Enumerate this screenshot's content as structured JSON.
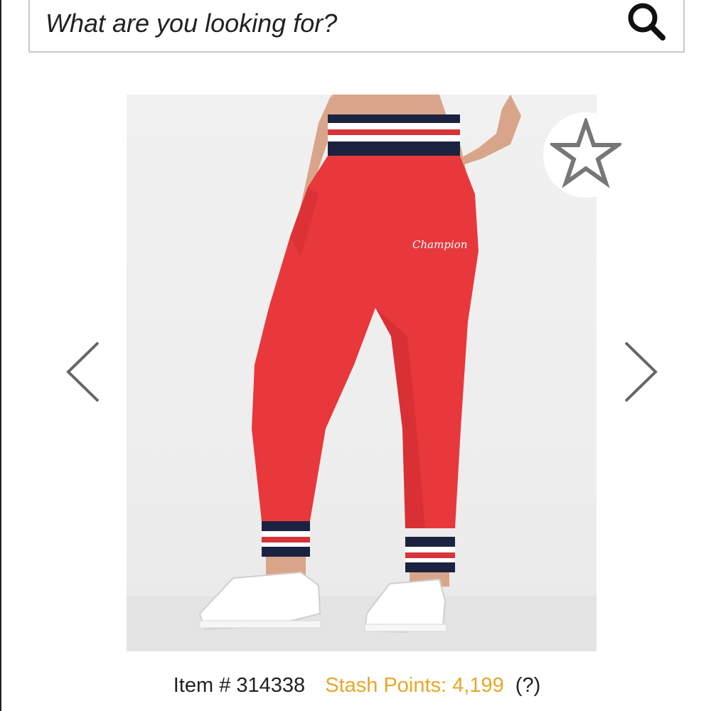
{
  "search": {
    "placeholder": "What are you looking for?",
    "icon": "search-icon"
  },
  "product": {
    "image_alt": "Red jogger sweatpants with striped waistband and cuffs, white sneakers",
    "brand_script": "Champion",
    "favorite_icon": "star-outline-icon",
    "prev_icon": "chevron-left-icon",
    "next_icon": "chevron-right-icon"
  },
  "item_info": {
    "item_label": "Item # 314338",
    "stash_label": "Stash Points: 4,199",
    "help_label": "(?)"
  },
  "colors": {
    "accent_stash": "#e6a72a",
    "pants_red": "#e8383c",
    "stripe_navy": "#1c2340"
  }
}
